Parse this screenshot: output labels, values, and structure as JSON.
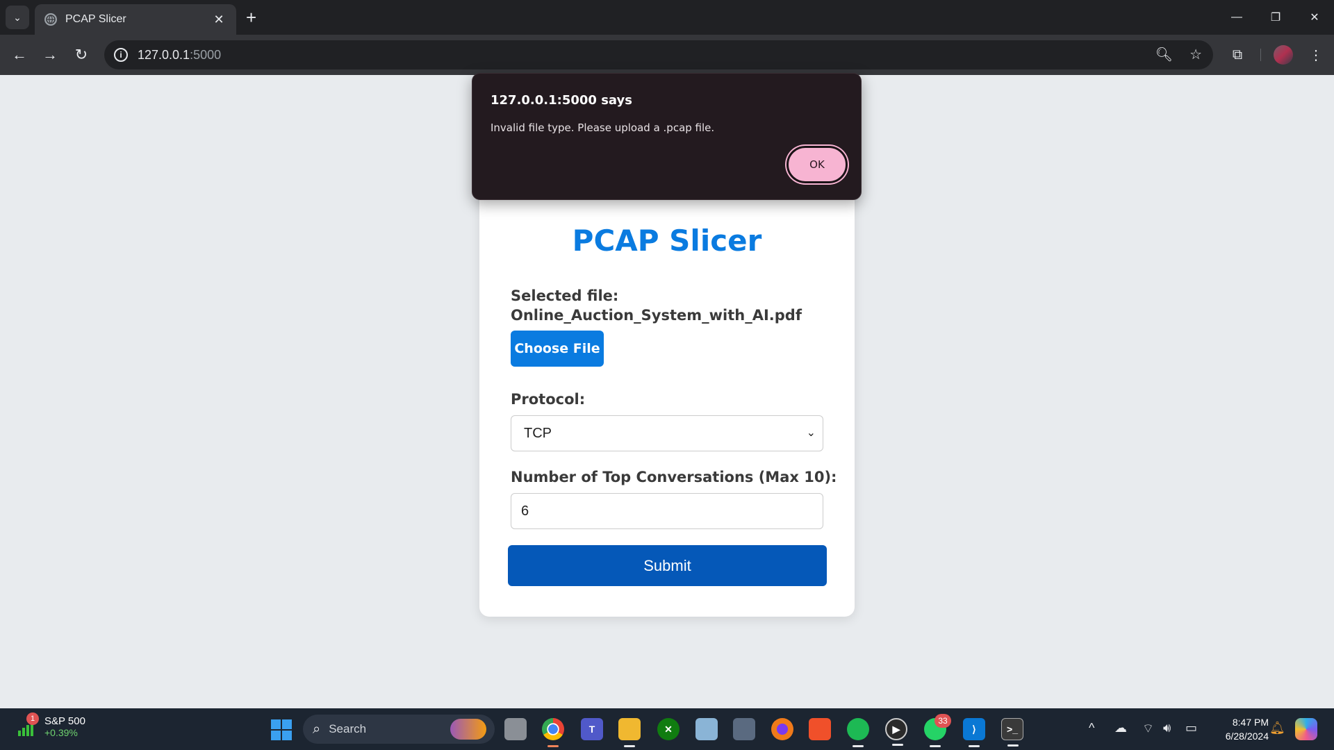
{
  "browser": {
    "tab_title": "PCAP Slicer",
    "tab_close": "✕",
    "new_tab": "+",
    "url_host": "127.0.0.1",
    "url_port": ":5000"
  },
  "dialog": {
    "title": "127.0.0.1:5000 says",
    "message": "Invalid file type. Please upload a .pcap file.",
    "ok_label": "OK"
  },
  "page": {
    "heading": "PCAP Slicer",
    "selected_file_label": "Selected file:",
    "selected_file_name": "Online_Auction_System_with_AI.pdf",
    "choose_file_label": "Choose File",
    "protocol_label": "Protocol:",
    "protocol_value": "TCP",
    "top_conv_label": "Number of Top Conversations (Max 10):",
    "top_conv_value": "6",
    "submit_label": "Submit"
  },
  "taskbar": {
    "stock_badge": "1",
    "stock_name": "S&P 500",
    "stock_change": "+0.39%",
    "search_text": "Search",
    "whatsapp_badge": "33",
    "time": "8:47 PM",
    "date": "6/28/2024"
  },
  "colors": {
    "accent": "#0a7be0",
    "submit": "#0558b8",
    "dialog_bg": "#231a1f",
    "ok_button": "#f7b4d2",
    "page_bg": "#e8ebee"
  }
}
